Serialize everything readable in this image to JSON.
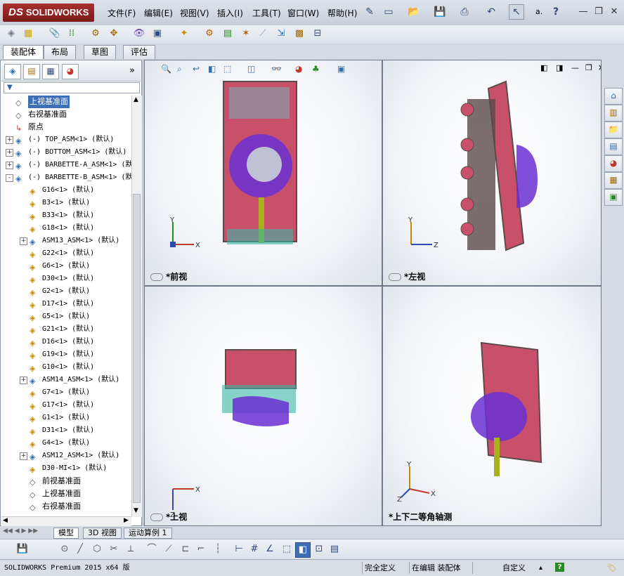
{
  "app": {
    "logo_prefix": "DS",
    "logo_text": "SOLIDWORKS"
  },
  "menu": [
    "文件(F)",
    "编辑(E)",
    "视图(V)",
    "插入(I)",
    "工具(T)",
    "窗口(W)",
    "帮助(H)"
  ],
  "title_tools": {
    "select_label": "a.",
    "help_label": "?"
  },
  "command_tabs": [
    "装配体",
    "布局",
    "草图",
    "评估"
  ],
  "tree": [
    {
      "label": "上视基准面",
      "type": "plane",
      "indent": 1,
      "selected": true
    },
    {
      "label": "右视基准面",
      "type": "plane",
      "indent": 1
    },
    {
      "label": "原点",
      "type": "origin",
      "indent": 1
    },
    {
      "label": "(-) TOP_ASM<1> (默认)",
      "type": "asm",
      "indent": 1,
      "expand": "+"
    },
    {
      "label": "(-) BOTTOM_ASM<1> (默认)",
      "type": "asm",
      "indent": 1,
      "expand": "+"
    },
    {
      "label": "(-) BARBETTE-A_ASM<1> (默",
      "type": "asm",
      "indent": 1,
      "expand": "+"
    },
    {
      "label": "(-) BARBETTE-B_ASM<1> (默",
      "type": "asm",
      "indent": 1,
      "expand": "-"
    },
    {
      "label": "G16<1> (默认)",
      "type": "part",
      "indent": 2
    },
    {
      "label": "B3<1> (默认)",
      "type": "part",
      "indent": 2
    },
    {
      "label": "B33<1> (默认)",
      "type": "part",
      "indent": 2
    },
    {
      "label": "G18<1> (默认)",
      "type": "part",
      "indent": 2
    },
    {
      "label": "ASM13_ASM<1> (默认)",
      "type": "asm",
      "indent": 2,
      "expand": "+"
    },
    {
      "label": "G22<1> (默认)",
      "type": "part",
      "indent": 2
    },
    {
      "label": "G6<1> (默认)",
      "type": "part",
      "indent": 2
    },
    {
      "label": "D30<1> (默认)",
      "type": "part",
      "indent": 2
    },
    {
      "label": "G2<1> (默认)",
      "type": "part",
      "indent": 2
    },
    {
      "label": "D17<1> (默认)",
      "type": "part",
      "indent": 2
    },
    {
      "label": "G5<1> (默认)",
      "type": "part",
      "indent": 2
    },
    {
      "label": "G21<1> (默认)",
      "type": "part",
      "indent": 2
    },
    {
      "label": "D16<1> (默认)",
      "type": "part",
      "indent": 2
    },
    {
      "label": "G19<1> (默认)",
      "type": "part",
      "indent": 2
    },
    {
      "label": "G10<1> (默认)",
      "type": "part",
      "indent": 2
    },
    {
      "label": "ASM14_ASM<1> (默认)",
      "type": "asm",
      "indent": 2,
      "expand": "+"
    },
    {
      "label": "G7<1> (默认)",
      "type": "part",
      "indent": 2
    },
    {
      "label": "G17<1> (默认)",
      "type": "part",
      "indent": 2
    },
    {
      "label": "G1<1> (默认)",
      "type": "part",
      "indent": 2
    },
    {
      "label": "D31<1> (默认)",
      "type": "part",
      "indent": 2
    },
    {
      "label": "G4<1> (默认)",
      "type": "part",
      "indent": 2
    },
    {
      "label": "ASM12_ASM<1> (默认)",
      "type": "asm",
      "indent": 2,
      "expand": "+"
    },
    {
      "label": "D30-MI<1> (默认)",
      "type": "part",
      "indent": 2
    },
    {
      "label": "前视基准面",
      "type": "plane",
      "indent": 2
    },
    {
      "label": "上视基准面",
      "type": "plane",
      "indent": 2
    },
    {
      "label": "右视基准面",
      "type": "plane",
      "indent": 2
    }
  ],
  "viewports": {
    "front": "*前视",
    "left": "*左视",
    "top": "*上视",
    "iso": "*上下二等角轴测"
  },
  "axis_labels": {
    "x": "X",
    "y": "Y",
    "z": "Z"
  },
  "bottom_tabs": [
    "模型",
    "3D 视图",
    "运动算例 1"
  ],
  "status": {
    "product": "SOLIDWORKS Premium 2015 x64 版",
    "defined": "完全定义",
    "editing": "在编辑 装配体",
    "custom": "自定义",
    "custom_arrow": "▴",
    "help": "?"
  },
  "colors": {
    "accent": "#3d6fb6",
    "brand": "#a8302e",
    "model_body": "#c9506a",
    "model_purple": "#6a2fd1",
    "model_teal": "#3ab5a5",
    "model_dark": "#5a4a4a"
  }
}
